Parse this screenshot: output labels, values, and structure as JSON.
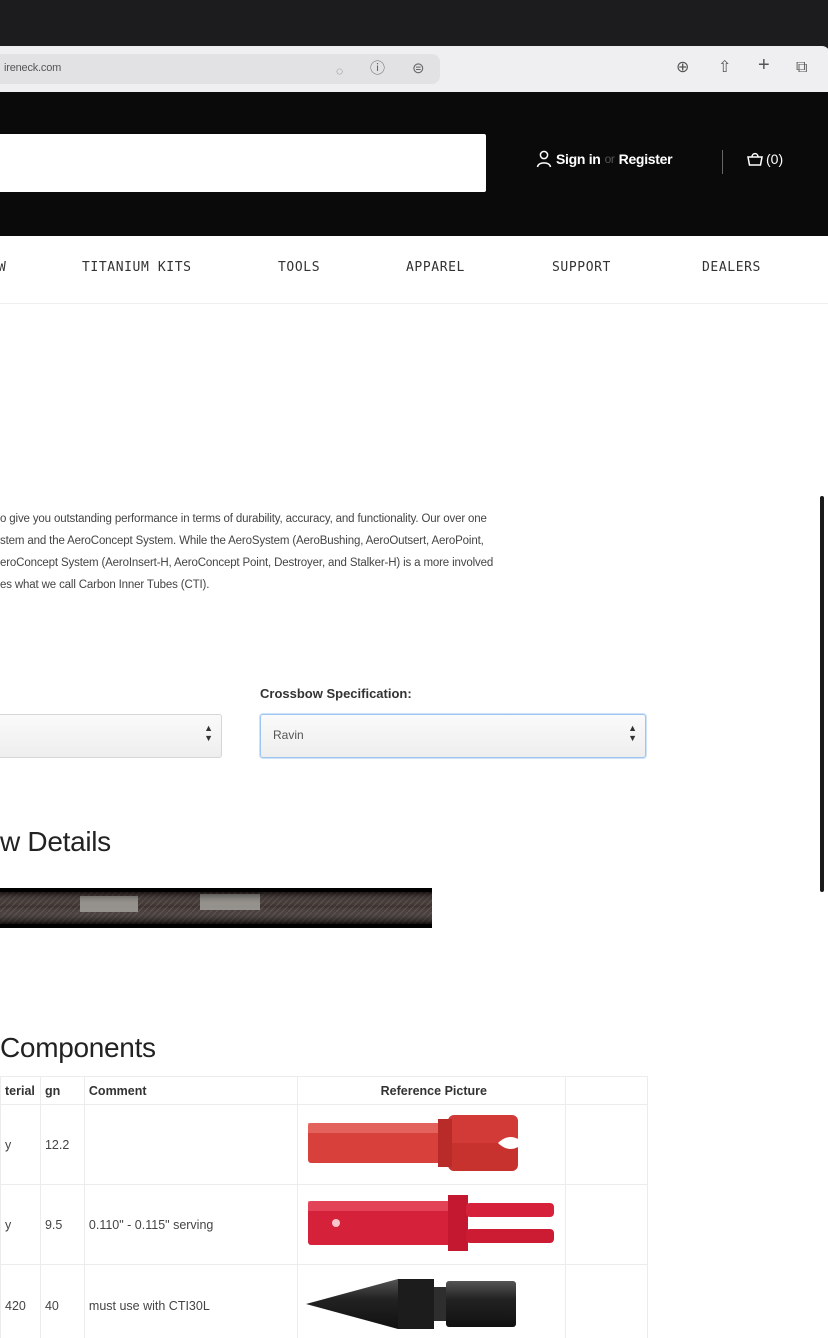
{
  "browser": {
    "url": "ireneck.com",
    "icons": [
      "reader-icon",
      "info-icon",
      "privacy-icon",
      "download-icon",
      "share-icon",
      "new-tab-icon",
      "tabs-icon"
    ]
  },
  "header": {
    "sign_in": "Sign in",
    "or": "or",
    "register": "Register",
    "cart": "(0)"
  },
  "nav": {
    "items": [
      "W",
      "TITANIUM KITS",
      "TOOLS",
      "APPAREL",
      "SUPPORT",
      "DEALERS"
    ]
  },
  "intro": {
    "lines": [
      "o give you outstanding performance in terms of durability, accuracy, and functionality.  Our over one",
      "stem and the AeroConcept System.  While the AeroSystem (AeroBushing, AeroOutsert, AeroPoint,",
      "eroConcept System (AeroInsert-H, AeroConcept Point, Destroyer, and Stalker-H) is a more involved",
      "es what we call Carbon Inner Tubes (CTI)."
    ]
  },
  "spec": {
    "label": "Crossbow Specification:",
    "left_value": "",
    "right_value": "Ravin"
  },
  "details": {
    "heading": "w Details"
  },
  "components": {
    "heading": "Components",
    "columns": [
      "terial",
      "gn",
      "Comment",
      "Reference Picture",
      ""
    ],
    "rows": [
      {
        "material": "y",
        "gn": "12.2",
        "comment": "",
        "picture": "nock-icon"
      },
      {
        "material": "y",
        "gn": "9.5",
        "comment": "0.110\" - 0.115\" serving",
        "picture": "flat-nock-icon"
      },
      {
        "material": "420",
        "gn": "40",
        "comment": "must use with CTI30L",
        "picture": "broadhead-point-icon"
      }
    ]
  },
  "colors": {
    "header_bg": "#0a0a0a",
    "nock_red": "#d8403c",
    "nock_red_bright": "#d6213a",
    "point_black": "#1c1c1c"
  }
}
